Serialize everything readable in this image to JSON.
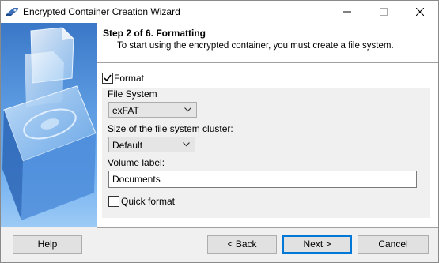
{
  "window": {
    "title": "Encrypted Container Creation Wizard",
    "controls": {
      "minimize": "minimize-icon",
      "maximize": "maximize-icon",
      "close": "close-icon"
    }
  },
  "header": {
    "title": "Step 2 of 6. Formatting",
    "subtitle": "To start using the encrypted container, you must create a file system."
  },
  "form": {
    "format_label": "Format",
    "format_checked": true,
    "group_label": "File System",
    "file_system_value": "exFAT",
    "cluster_label": "Size of the file system cluster:",
    "cluster_value": "Default",
    "volume_label_label": "Volume label:",
    "volume_label_value": "Documents",
    "quick_format_label": "Quick format",
    "quick_format_checked": false
  },
  "buttons": {
    "help": "Help",
    "back": "< Back",
    "next": "Next >",
    "cancel": "Cancel"
  },
  "colors": {
    "accent": "#0078d7",
    "sidebar_blue": "#5b9ae0"
  }
}
